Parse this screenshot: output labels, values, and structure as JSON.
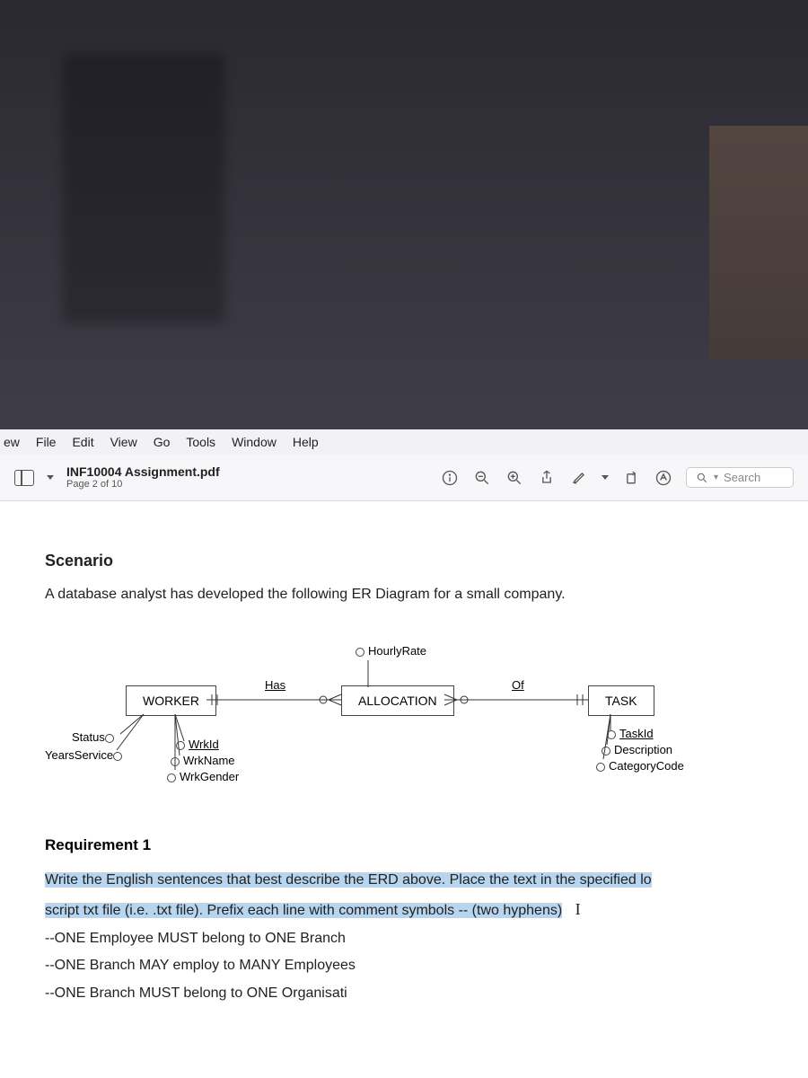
{
  "menubar": [
    "ew",
    "File",
    "Edit",
    "View",
    "Go",
    "Tools",
    "Window",
    "Help"
  ],
  "toolbar": {
    "doc_title": "INF10004 Assignment.pdf",
    "page_label": "Page 2 of 10",
    "search_placeholder": "Search"
  },
  "doc": {
    "scenario_heading": "Scenario",
    "scenario_text": "A database analyst has developed the following ER Diagram for a small company.",
    "erd": {
      "entities": {
        "worker": "WORKER",
        "allocation": "ALLOCATION",
        "task": "TASK"
      },
      "relationships": {
        "has": "Has",
        "of": "Of"
      },
      "attributes": {
        "worker_side": {
          "status": "Status",
          "years_service": "YearsService"
        },
        "worker_right": {
          "wrkid": "WrkId",
          "wrkname": "WrkName",
          "wrkgender": "WrkGender"
        },
        "allocation": {
          "hourly_rate": "HourlyRate"
        },
        "task": {
          "taskid": "TaskId",
          "description": "Description",
          "categorycode": "CategoryCode"
        }
      }
    },
    "req1_heading": "Requirement 1",
    "req1_p1a": "Write the English sentences that best describe the ERD above. Place the text in the specified lo",
    "req1_p2a": "script txt file (i.e. .txt file). Prefix each line with comment symbols -- (two hyphens)",
    "cursor": "I",
    "example_line1": "--ONE Employee MUST belong to ONE Branch",
    "example_line2": "--ONE Branch MAY employ to MANY Employees",
    "example_line3": "--ONE Branch MUST belong to ONE Organisati"
  }
}
